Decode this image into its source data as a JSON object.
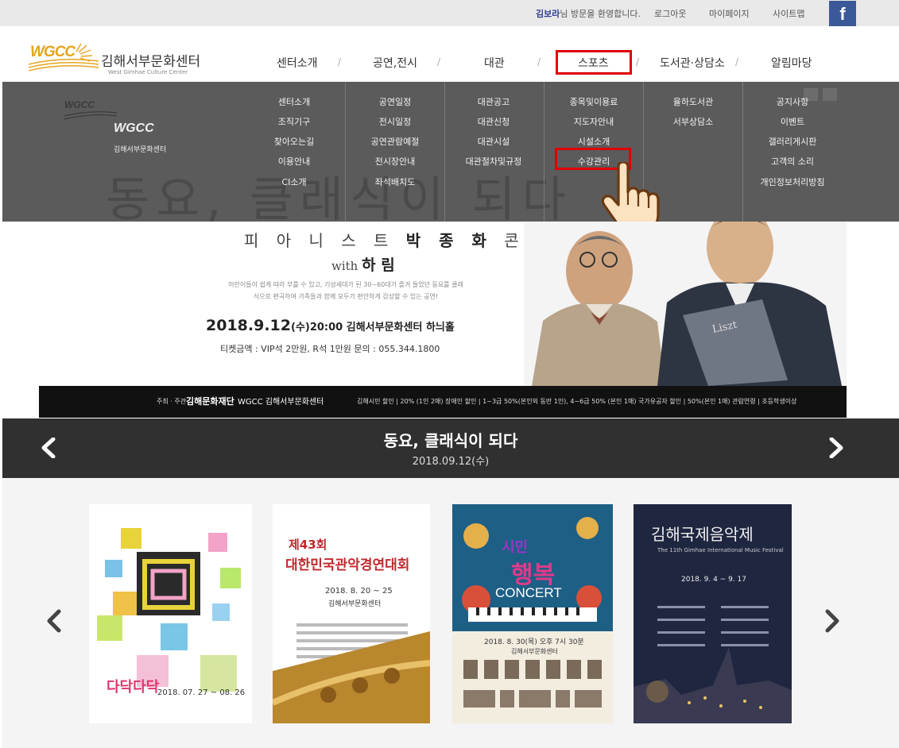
{
  "topbar": {
    "user_name": "김보라",
    "welcome_suffix": "님 방문을 환영합니다.",
    "logout": "로그아웃",
    "mypage": "마이페이지",
    "sitemap": "사이트맵",
    "facebook_glyph": "f"
  },
  "header": {
    "logo_mark": "WGCC",
    "logo_name": "김해서부문화센터",
    "logo_eng": "West Gimhae Culture Center",
    "nav": [
      "센터소개",
      "공연,전시",
      "대관",
      "스포츠",
      "도서관·상담소",
      "알림마당"
    ],
    "separator": "/"
  },
  "mega_menu": {
    "watermark": "동요, 클래식이 되다",
    "logo_mark": "WGCC",
    "logo_name": "김해서부문화센터",
    "columns": [
      [
        "센터소개",
        "조직기구",
        "찾아오는길",
        "이용안내",
        "CI소개"
      ],
      [
        "공연일정",
        "전시일정",
        "공연관람예절",
        "전시장안내",
        "좌석배치도"
      ],
      [
        "대관공고",
        "대관신청",
        "대관시설",
        "대관절차및규정"
      ],
      [
        "종목및이용료",
        "지도자안내",
        "시설소개",
        "수강관리"
      ],
      [
        "율하도서관",
        "서부상담소"
      ],
      [
        "공지사항",
        "이벤트",
        "갤러리게시판",
        "고객의 소리",
        "개인정보처리방침"
      ]
    ]
  },
  "hero": {
    "title_a": "피 아 니 스 트 ",
    "title_b": "박 종 화",
    "title_c": " 콘 서 트",
    "sub_with": "with ",
    "sub_name": "하 림",
    "desc": "어린이들이 쉽게 따라 부를 수 있고, 기성세대가 된 30~60대가 즐겨 들었던 동요를 클래식으로 편곡하여 가족들과 함께 모두가 편안하게 감상할 수 있는 공연!",
    "date": "2018.9.12",
    "date_time": "(수)20:00 김해서부문화센터 하늬홀",
    "ticket": "티켓금액 : VIP석 2만원, R석 1만원   문의 : 055.344.1800",
    "sponsor_host": "주최 · 주관",
    "sponsor_org1": "김해문화재단",
    "sponsor_org2": "WGCC 김해서부문화센터",
    "discounts": "김해시민 할인 | 20% (1인 2매)   장애인 할인 | 1~3급 50%(본인외 동반 1인), 4~6급 50% (본인 1매)   국가유공자 할인 | 50%(본인 1매)   관람연령 | 초등학생이상"
  },
  "caption": {
    "title": "동요, 클래식이 되다",
    "date": "2018.09.12(수)"
  },
  "posters": [
    {
      "main": "다닥다닥",
      "dates": "2018. 07. 27 ~ 08. 26"
    },
    {
      "edition": "제43회",
      "title": "대한민국관악경연대회",
      "dates": "2018. 8. 20 ~ 25",
      "venue": "김해서부문화센터"
    },
    {
      "title_a": "시민",
      "title_b": "행복",
      "title_c": "CONCERT",
      "dates": "2018. 8. 30(목) 오후 7시 30분",
      "venue": "김해서부문화센터"
    },
    {
      "title": "김해국제음악제",
      "eng": "The 11th Gimhae International Music Festival",
      "dates": "2018. 9. 4 ~ 9. 17"
    }
  ],
  "colors": {
    "highlight": "#e00000",
    "mega_bg": "#5b5b5b",
    "caption_bg": "#303030",
    "facebook": "#3b5998",
    "logo_gold": "#e5a41c"
  },
  "icons": [
    "facebook-icon",
    "chevron-left-icon",
    "chevron-right-icon",
    "pointing-hand-icon"
  ]
}
